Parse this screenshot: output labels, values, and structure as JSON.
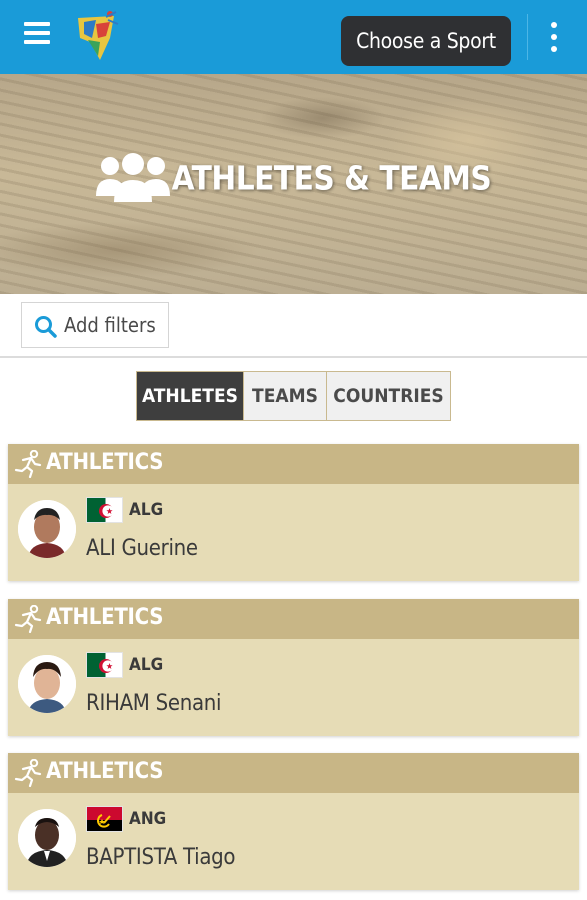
{
  "app": {
    "choose_sport_label": "Choose a Sport",
    "menu_icon": "hamburger-icon",
    "overflow_icon": "kebab-menu-icon",
    "brand_color": "#1a9bd8"
  },
  "hero": {
    "title": "ATHLETES & TEAMS",
    "icon": "users-group-icon"
  },
  "filters": {
    "label": "Add filters",
    "icon": "search-icon"
  },
  "tabs": [
    {
      "label": "ATHLETES",
      "active": true
    },
    {
      "label": "TEAMS",
      "active": false
    },
    {
      "label": "COUNTRIES",
      "active": false
    }
  ],
  "athletes": [
    {
      "sport": "ATHLETICS",
      "sport_icon": "running-icon",
      "country_code": "ALG",
      "flag": "algeria-flag",
      "name": "ALI Guerine"
    },
    {
      "sport": "ATHLETICS",
      "sport_icon": "running-icon",
      "country_code": "ALG",
      "flag": "algeria-flag",
      "name": "RIHAM Senani"
    },
    {
      "sport": "ATHLETICS",
      "sport_icon": "running-icon",
      "country_code": "ANG",
      "flag": "angola-flag",
      "name": "BAPTISTA Tiago"
    }
  ]
}
